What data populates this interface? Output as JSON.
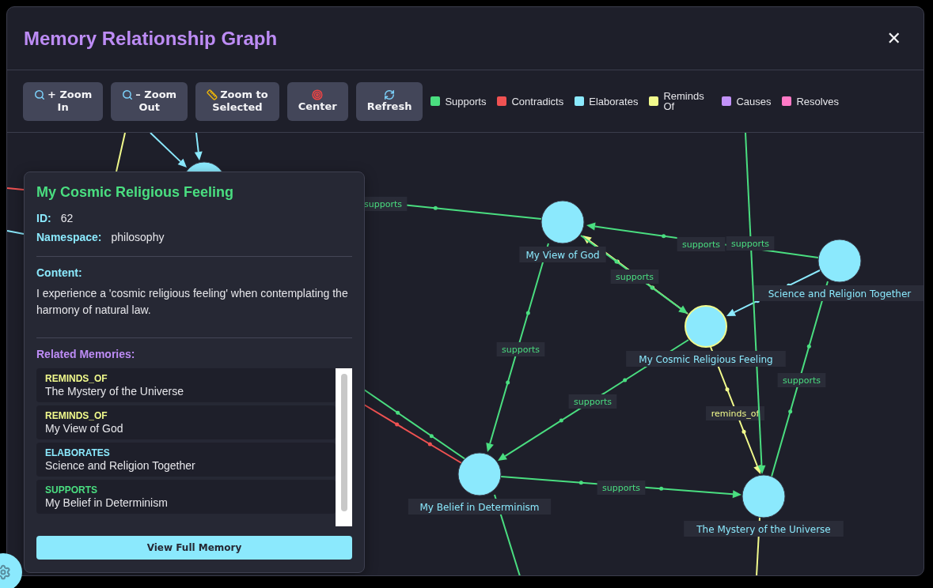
{
  "dialog": {
    "title": "Memory Relationship Graph",
    "close": "✕"
  },
  "toolbar": {
    "buttons": [
      {
        "label": "+ Zoom In"
      },
      {
        "label": "– Zoom Out"
      },
      {
        "label": "Zoom to Selected"
      },
      {
        "label": "Center"
      },
      {
        "label": "Refresh"
      }
    ],
    "legend": [
      {
        "label": "Supports",
        "color": "#4ade80"
      },
      {
        "label": "Contradicts",
        "color": "#f05252"
      },
      {
        "label": "Elaborates",
        "color": "#8be9fd"
      },
      {
        "label": "Reminds Of",
        "color": "#f1fa8c"
      },
      {
        "label": "Causes",
        "color": "#c292f9"
      },
      {
        "label": "Resolves",
        "color": "#ff79c6"
      }
    ]
  },
  "graph": {
    "nodes": [
      {
        "label": "My View of God",
        "selected": false
      },
      {
        "label": "My Cosmic Religious Feeling",
        "selected": true
      },
      {
        "label": "Science and Religion Together",
        "selected": false
      },
      {
        "label": "My Belief in Determinism",
        "selected": false
      },
      {
        "label": "The Mystery of the Universe",
        "selected": false
      },
      {
        "selected": false
      }
    ],
    "edges": [
      {
        "kind": "supports",
        "label": "supports"
      },
      {
        "kind": "supports",
        "label": "supports"
      },
      {
        "kind": "reminds_of"
      },
      {
        "kind": "supports",
        "label": "supports"
      },
      {
        "kind": "elaborates"
      },
      {
        "kind": "supports",
        "label": "supports"
      },
      {
        "kind": "supports",
        "label": "supports"
      },
      {
        "kind": "reminds_of",
        "label": "reminds_of"
      },
      {
        "kind": "supports",
        "label": "supports"
      },
      {
        "kind": "supports",
        "label": "supports"
      },
      {
        "kind": "supports",
        "label": "supports"
      },
      {
        "kind": "supports"
      },
      {
        "kind": "reminds_of"
      },
      {
        "kind": "supports"
      },
      {
        "kind": "contradicts"
      },
      {
        "kind": "contradicts"
      },
      {
        "kind": "elaborates"
      },
      {
        "kind": "reminds_of"
      },
      {
        "kind": "elaborates"
      },
      {
        "kind": "elaborates"
      }
    ]
  },
  "details": {
    "title": "My Cosmic Religious Feeling",
    "id_label": "ID:",
    "id": "62",
    "namespace_label": "Namespace:",
    "namespace": "philosophy",
    "content_label": "Content:",
    "content": "I experience a 'cosmic religious feeling' when contemplating the harmony of natural law.",
    "related_label": "Related Memories:",
    "related": [
      {
        "kind": "reminds_of",
        "relation": "REMINDS_OF",
        "title": "The Mystery of the Universe"
      },
      {
        "kind": "reminds_of",
        "relation": "REMINDS_OF",
        "title": "My View of God"
      },
      {
        "kind": "elaborates",
        "relation": "ELABORATES",
        "title": "Science and Religion Together"
      },
      {
        "kind": "supports",
        "relation": "SUPPORTS",
        "title": "My Belief in Determinism"
      }
    ],
    "action": "View Full Memory"
  }
}
